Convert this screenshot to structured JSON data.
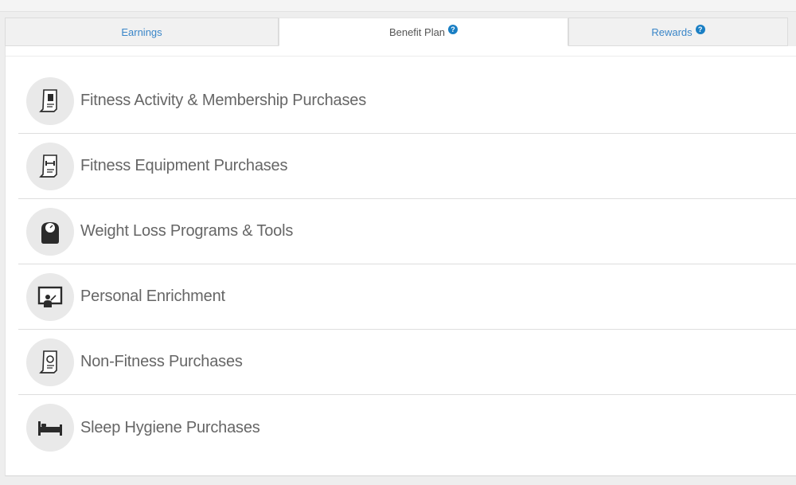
{
  "tabs": [
    {
      "label": "Earnings",
      "active": false,
      "help": false
    },
    {
      "label": "Benefit Plan",
      "active": true,
      "help": true
    },
    {
      "label": "Rewards",
      "active": false,
      "help": true
    }
  ],
  "help_glyph": "?",
  "items": [
    {
      "label": "Fitness Activity & Membership Purchases",
      "icon": "receipt-fitness-icon"
    },
    {
      "label": "Fitness Equipment Purchases",
      "icon": "receipt-equipment-icon"
    },
    {
      "label": "Weight Loss Programs & Tools",
      "icon": "scale-icon"
    },
    {
      "label": "Personal Enrichment",
      "icon": "presentation-board-icon"
    },
    {
      "label": "Non-Fitness Purchases",
      "icon": "receipt-generic-icon"
    },
    {
      "label": "Sleep Hygiene Purchases",
      "icon": "bed-icon"
    }
  ],
  "colors": {
    "tab_link": "#3a86c8",
    "help_badge": "#1a7fc4",
    "icon_fill": "#2b2b2b",
    "label": "#666666"
  }
}
